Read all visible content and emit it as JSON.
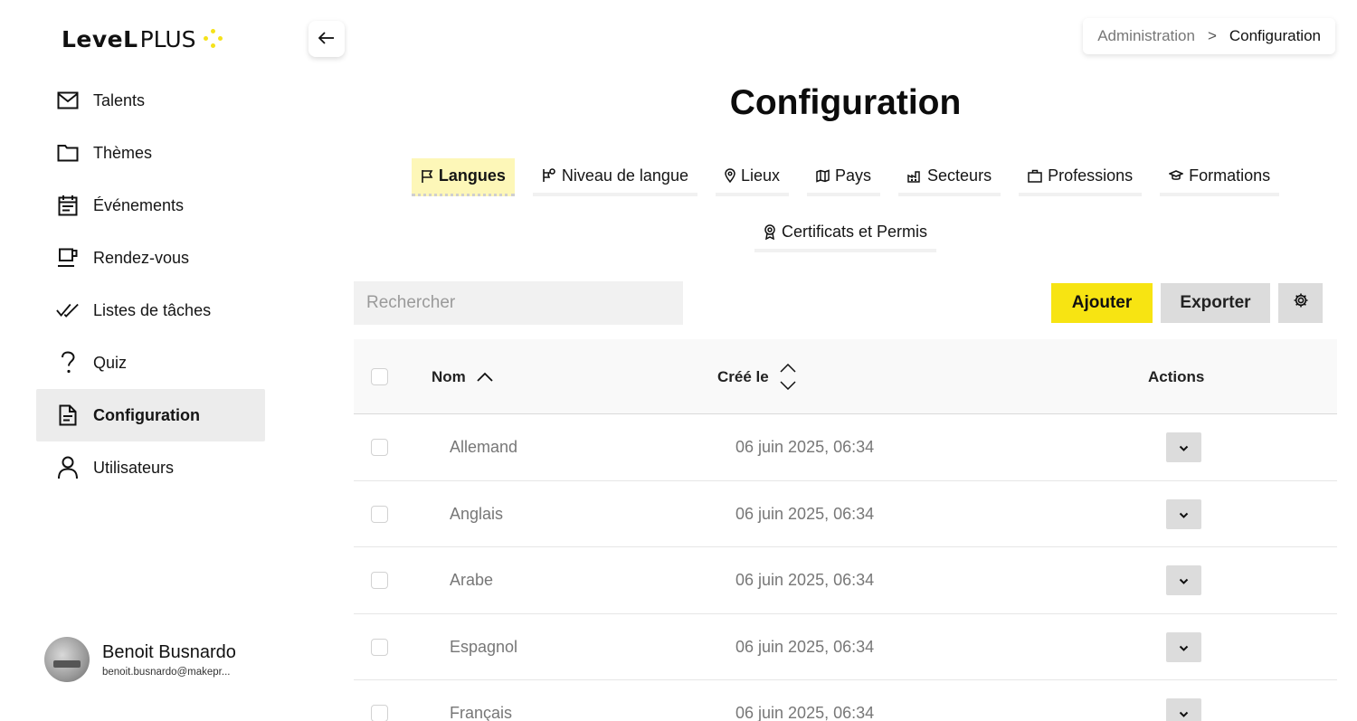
{
  "app": {
    "logo_bold": "LeveL",
    "logo_light": "PLUS"
  },
  "sidebar": {
    "items": [
      {
        "label": "Talents",
        "icon": "mail-icon"
      },
      {
        "label": "Thèmes",
        "icon": "folder-icon"
      },
      {
        "label": "Événements",
        "icon": "calendar-icon"
      },
      {
        "label": "Rendez-vous",
        "icon": "coffee-icon"
      },
      {
        "label": "Listes de tâches",
        "icon": "double-check-icon"
      },
      {
        "label": "Quiz",
        "icon": "question-icon"
      },
      {
        "label": "Configuration",
        "icon": "document-icon",
        "active": true
      },
      {
        "label": "Utilisateurs",
        "icon": "user-icon"
      }
    ],
    "user": {
      "name": "Benoit Busnardo",
      "email": "benoit.busnardo@makepr..."
    }
  },
  "breadcrumb": {
    "parent": "Administration",
    "separator": ">",
    "current": "Configuration"
  },
  "page": {
    "title": "Configuration"
  },
  "tabs": [
    {
      "label": "Langues",
      "icon": "flag-icon",
      "active": true
    },
    {
      "label": "Niveau de langue",
      "icon": "flag-level-icon"
    },
    {
      "label": "Lieux",
      "icon": "pin-icon"
    },
    {
      "label": "Pays",
      "icon": "map-icon"
    },
    {
      "label": "Secteurs",
      "icon": "factory-icon"
    },
    {
      "label": "Professions",
      "icon": "briefcase-icon"
    },
    {
      "label": "Formations",
      "icon": "graduation-icon"
    },
    {
      "label": "Certificats et Permis",
      "icon": "award-icon"
    }
  ],
  "toolbar": {
    "search_placeholder": "Rechercher",
    "add_label": "Ajouter",
    "export_label": "Exporter"
  },
  "table": {
    "columns": {
      "name": "Nom",
      "created": "Créé le",
      "actions": "Actions"
    },
    "rows": [
      {
        "name": "Allemand",
        "created": "06 juin 2025, 06:34"
      },
      {
        "name": "Anglais",
        "created": "06 juin 2025, 06:34"
      },
      {
        "name": "Arabe",
        "created": "06 juin 2025, 06:34"
      },
      {
        "name": "Espagnol",
        "created": "06 juin 2025, 06:34"
      },
      {
        "name": "Français",
        "created": "06 juin 2025, 06:34"
      }
    ]
  },
  "colors": {
    "accent": "#f7e412",
    "active_tab_bg": "#fdf7b8",
    "active_nav_bg": "#ececec"
  }
}
